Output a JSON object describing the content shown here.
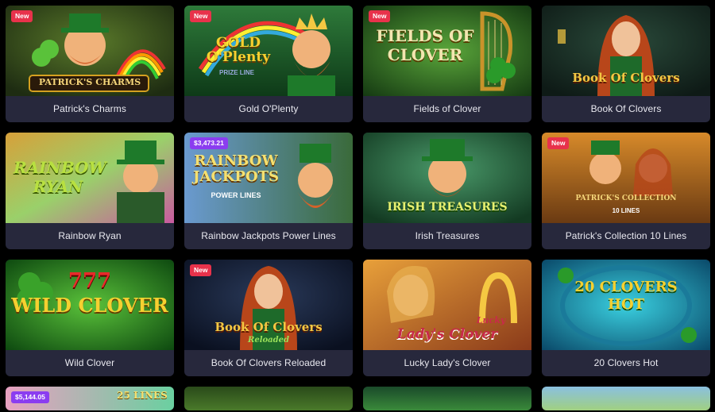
{
  "colors": {
    "background": "#000000",
    "card": "#27283c",
    "label_text": "#e9e9f0",
    "badge_new": "#e8324b",
    "badge_jackpot": "#8b3df0"
  },
  "games": [
    {
      "title": "Patrick's Charms",
      "badge": "New",
      "logo": "PATRICK'S CHARMS"
    },
    {
      "title": "Gold O'Plenty",
      "badge": "New",
      "logo": "GOLD O'Plenty"
    },
    {
      "title": "Fields of Clover",
      "badge": "New",
      "logo": "FIELDS OF CLOVER"
    },
    {
      "title": "Book Of Clovers",
      "badge": "",
      "logo": "Book Of Clovers"
    },
    {
      "title": "Rainbow Ryan",
      "badge": "",
      "logo": "RAINBOW RYAN"
    },
    {
      "title": "Rainbow Jackpots Power Lines",
      "badge": "$3,473.21",
      "logo": "RAINBOW JACKPOTS"
    },
    {
      "title": "Irish Treasures",
      "badge": "",
      "logo": "IRISH TREASURES"
    },
    {
      "title": "Patrick's Collection 10 Lines",
      "badge": "New",
      "logo": "PATRICK'S COLLECTION"
    },
    {
      "title": "Wild Clover",
      "badge": "",
      "logo": "WILD CLOVER"
    },
    {
      "title": "Book Of Clovers Reloaded",
      "badge": "New",
      "logo": "Book Of Clovers"
    },
    {
      "title": "Lucky Lady's Clover",
      "badge": "",
      "logo": "Lady's Clover"
    },
    {
      "title": "20 Clovers Hot",
      "badge": "",
      "logo": "20 CLOVERS HOT"
    }
  ],
  "logo_extras": {
    "gold_prize_line": "PRIZE LINE",
    "rainbow_power_lines": "POWER LINES",
    "patricks_10_lines": "10 LINES",
    "book_reloaded": "Reloaded",
    "lucky_word": "Lucky",
    "wild_777": "777"
  },
  "partial_row": [
    {
      "badge": "$5,144.05",
      "logo": "25 LINES"
    },
    {
      "badge": "",
      "logo": ""
    },
    {
      "badge": "",
      "logo": ""
    },
    {
      "badge": "",
      "logo": ""
    }
  ]
}
